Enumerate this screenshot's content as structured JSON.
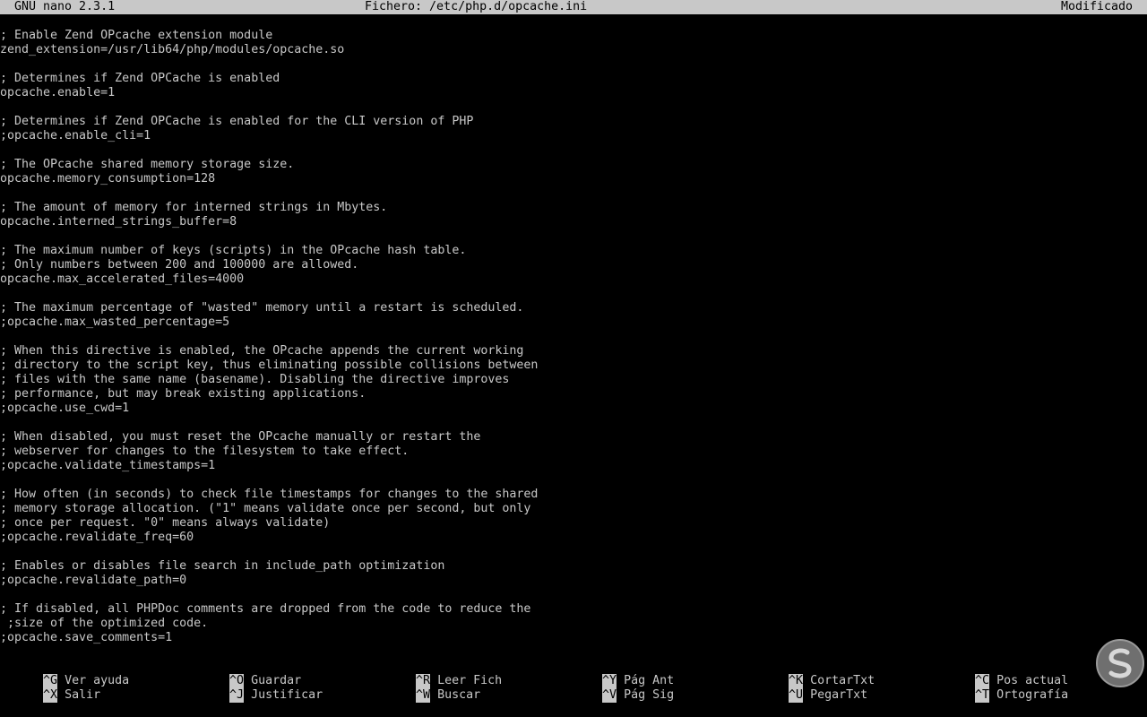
{
  "titlebar": {
    "app": "GNU nano 2.3.1",
    "file": "Fichero: /etc/php.d/opcache.ini",
    "status": "Modificado"
  },
  "editor": {
    "lines": [
      "; Enable Zend OPcache extension module",
      "zend_extension=/usr/lib64/php/modules/opcache.so",
      "",
      "; Determines if Zend OPCache is enabled",
      "opcache.enable=1",
      "",
      "; Determines if Zend OPCache is enabled for the CLI version of PHP",
      ";opcache.enable_cli=1",
      "",
      "; The OPcache shared memory storage size.",
      "opcache.memory_consumption=128",
      "",
      "; The amount of memory for interned strings in Mbytes.",
      "opcache.interned_strings_buffer=8",
      "",
      "; The maximum number of keys (scripts) in the OPcache hash table.",
      "; Only numbers between 200 and 100000 are allowed.",
      "opcache.max_accelerated_files=4000",
      "",
      "; The maximum percentage of \"wasted\" memory until a restart is scheduled.",
      ";opcache.max_wasted_percentage=5",
      "",
      "; When this directive is enabled, the OPcache appends the current working",
      "; directory to the script key, thus eliminating possible collisions between",
      "; files with the same name (basename). Disabling the directive improves",
      "; performance, but may break existing applications.",
      ";opcache.use_cwd=1",
      "",
      "; When disabled, you must reset the OPcache manually or restart the",
      "; webserver for changes to the filesystem to take effect.",
      ";opcache.validate_timestamps=1",
      "",
      "; How often (in seconds) to check file timestamps for changes to the shared",
      "; memory storage allocation. (\"1\" means validate once per second, but only",
      "; once per request. \"0\" means always validate)",
      ";opcache.revalidate_freq=60",
      "",
      "; Enables or disables file search in include_path optimization",
      ";opcache.revalidate_path=0",
      "",
      "; If disabled, all PHPDoc comments are dropped from the code to reduce the",
      " ;size of the optimized code.",
      ";opcache.save_comments=1"
    ]
  },
  "shortcuts": {
    "row1": [
      {
        "key": "^G",
        "label": "Ver ayuda"
      },
      {
        "key": "^O",
        "label": "Guardar"
      },
      {
        "key": "^R",
        "label": "Leer Fich"
      },
      {
        "key": "^Y",
        "label": "Pág Ant"
      },
      {
        "key": "^K",
        "label": "CortarTxt"
      },
      {
        "key": "^C",
        "label": "Pos actual"
      }
    ],
    "row2": [
      {
        "key": "^X",
        "label": "Salir"
      },
      {
        "key": "^J",
        "label": "Justificar"
      },
      {
        "key": "^W",
        "label": "Buscar"
      },
      {
        "key": "^V",
        "label": "Pág Sig"
      },
      {
        "key": "^U",
        "label": "PegarTxt"
      },
      {
        "key": "^T",
        "label": "Ortografía"
      }
    ]
  },
  "colors": {
    "background": "#000000",
    "text": "#c8c8c8",
    "inverse_bg": "#c8c8c8",
    "inverse_text": "#000000"
  },
  "watermark": {
    "icon": "solvetic-logo-icon"
  }
}
